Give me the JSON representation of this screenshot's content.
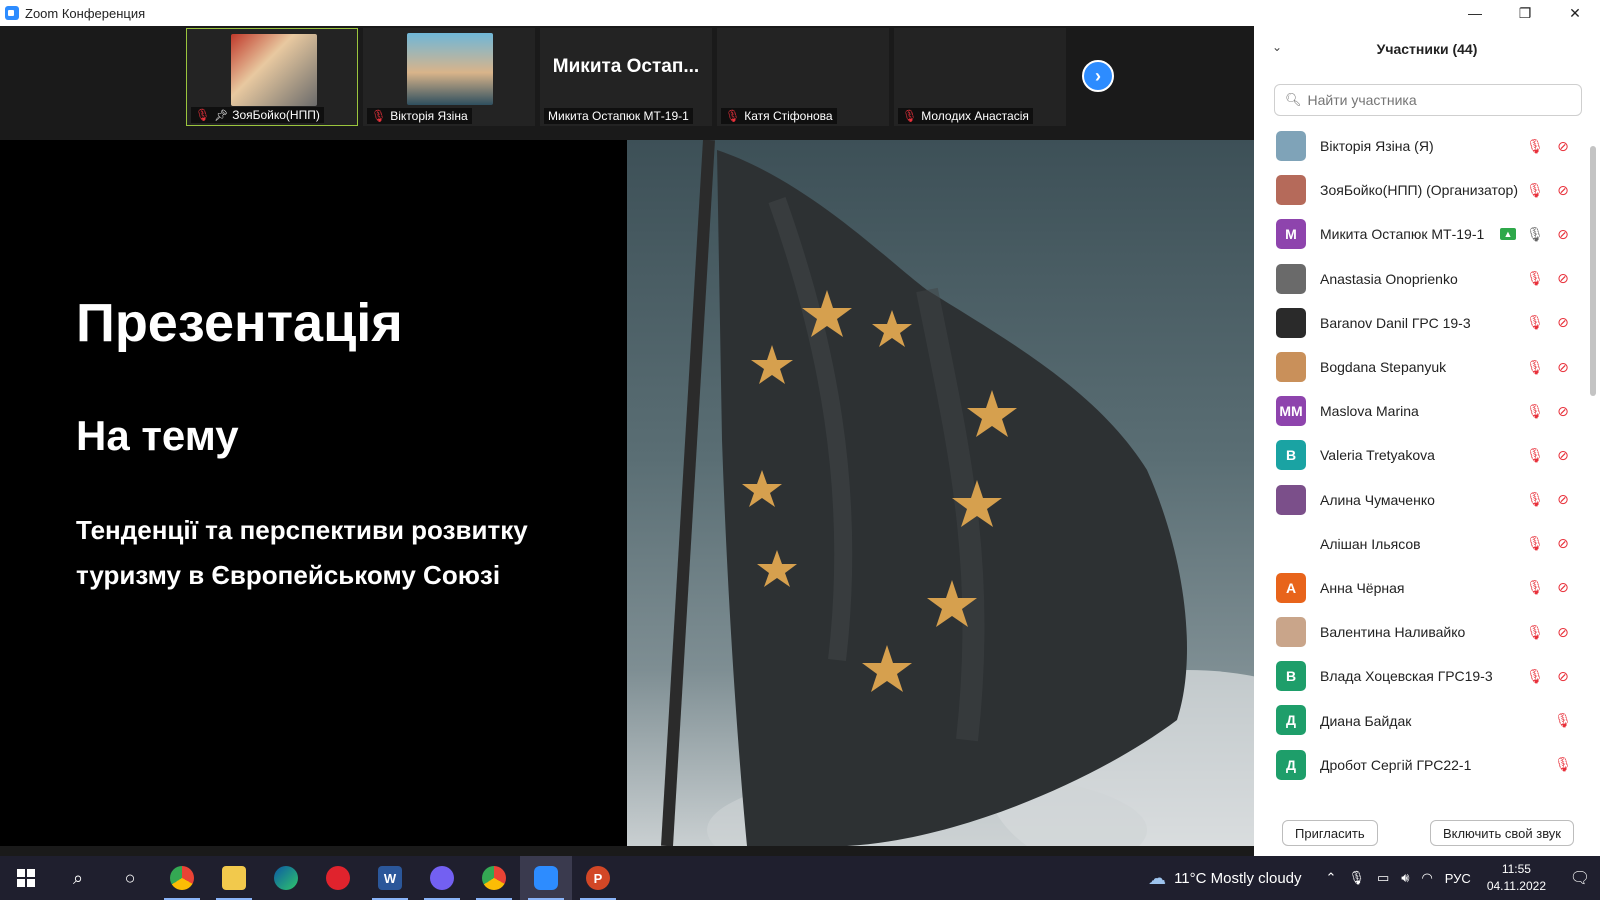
{
  "window": {
    "title": "Zoom Конференция",
    "minimize": "—",
    "restore": "❐",
    "close": "✕"
  },
  "gallery": {
    "tiles": [
      {
        "label": "ЗояБойко(НПП)"
      },
      {
        "label": "Вікторія Язіна"
      },
      {
        "big_name": "Микита  Остап...",
        "label": "Микита Остапюк МТ-19-1"
      },
      {
        "label": "Катя Стіфонова"
      },
      {
        "label": "Молодих Анастасія"
      }
    ],
    "next_icon": "chevron-right-icon"
  },
  "slide": {
    "title": "Презентація",
    "subtitle": "На тему",
    "topic": "Тенденції та перспективи розвитку туризму в Європейському Союзі"
  },
  "participants": {
    "header": "Участники (44)",
    "search_placeholder": "Найти участника",
    "list": [
      {
        "name": "Вікторія Язіна (Я)",
        "avatar": "",
        "avatar_color": "#7fa3b8"
      },
      {
        "name": "ЗояБойко(НПП) (Организатор)",
        "avatar": "",
        "avatar_color": "#b56a5a"
      },
      {
        "name": "Микита Остапюк МТ-19-1",
        "avatar": "М",
        "avatar_color": "#8e44ad"
      },
      {
        "name": "Anastasia Onoprienko",
        "avatar": "",
        "avatar_color": "#6a6a6a"
      },
      {
        "name": "Baranov Danil ГРС 19-3",
        "avatar": "",
        "avatar_color": "#2a2a2a"
      },
      {
        "name": "Bogdana Stepanyuk",
        "avatar": "",
        "avatar_color": "#c9905a"
      },
      {
        "name": "Maslova Marina",
        "avatar": "ММ",
        "avatar_color": "#8e44ad"
      },
      {
        "name": "Valeria Tretyakova",
        "avatar": "В",
        "avatar_color": "#1aa3a3"
      },
      {
        "name": "Алина Чумаченко",
        "avatar": "",
        "avatar_color": "#7b4f8a"
      },
      {
        "name": "Алішан Ільясов",
        "avatar": "",
        "avatar_color": "#ffffff"
      },
      {
        "name": "Анна Чёрная",
        "avatar": "А",
        "avatar_color": "#e8641b"
      },
      {
        "name": "Валентина Наливайко",
        "avatar": "",
        "avatar_color": "#c9a58a"
      },
      {
        "name": "Влада Хоцевская ГРС19-3",
        "avatar": "В",
        "avatar_color": "#1e9e6a"
      },
      {
        "name": "Диана Байдак",
        "avatar": "Д",
        "avatar_color": "#1e9e6a"
      },
      {
        "name": "Дробот Сергій ГРС22-1",
        "avatar": "Д",
        "avatar_color": "#1e9e6a"
      }
    ],
    "invite_button": "Пригласить",
    "unmute_button": "Включить свой звук"
  },
  "taskbar": {
    "weather": "11°C  Mostly cloudy",
    "lang": "РУС",
    "time": "11:55",
    "date": "04.11.2022",
    "word_label": "W",
    "ppt_label": "P"
  },
  "colors": {
    "accent": "#2d8cff",
    "muted_red": "#e8313b",
    "active_border": "#9bc53d"
  }
}
